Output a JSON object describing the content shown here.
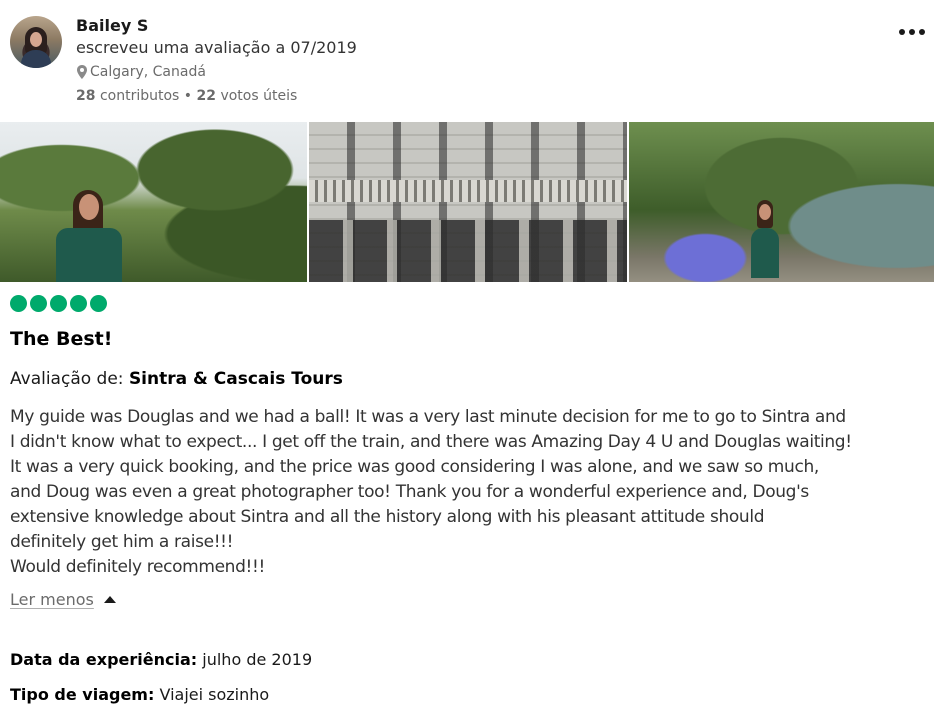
{
  "header": {
    "username": "Bailey S",
    "review_meta": "escreveu uma avaliação a 07/2019",
    "location": "Calgary, Canadá",
    "contributions_count": "28",
    "contributions_label": "contributos",
    "separator": "•",
    "helpful_votes_count": "22",
    "helpful_votes_label": "votos úteis",
    "avatar_icon": "user-avatar-photo",
    "location_icon": "map-pin-icon",
    "more_icon": "more-horizontal-icon"
  },
  "photos": [
    {
      "alt_icon": "review-photo-forest"
    },
    {
      "alt_icon": "review-photo-palace"
    },
    {
      "alt_icon": "review-photo-garden"
    }
  ],
  "rating": {
    "value": 5,
    "max": 5,
    "color": "#00aa6c"
  },
  "review": {
    "title": "The Best!",
    "reviewed_prefix": "Avaliação de:",
    "reviewed_subject": "Sintra & Cascais Tours",
    "body": "My guide was Douglas and we had a ball! It was a very last minute decision for me to go to Sintra and\nI didn't know what to expect... I get off the train, and there was Amazing Day 4 U and Douglas waiting!\nIt was a very quick booking, and the price was good considering I was alone, and we saw so much,\nand Doug was even a great photographer too! Thank you for a wonderful experience and, Doug's\nextensive knowledge about Sintra and all the history along with his pleasant attitude should\ndefinitely get him a raise!!!\nWould definitely recommend!!!",
    "read_less_label": "Ler menos",
    "read_less_icon": "caret-up-icon"
  },
  "details": {
    "experience_date_label": "Data da experiência:",
    "experience_date_value": "julho de 2019",
    "trip_type_label": "Tipo de viagem:",
    "trip_type_value": "Viajei sozinho"
  }
}
